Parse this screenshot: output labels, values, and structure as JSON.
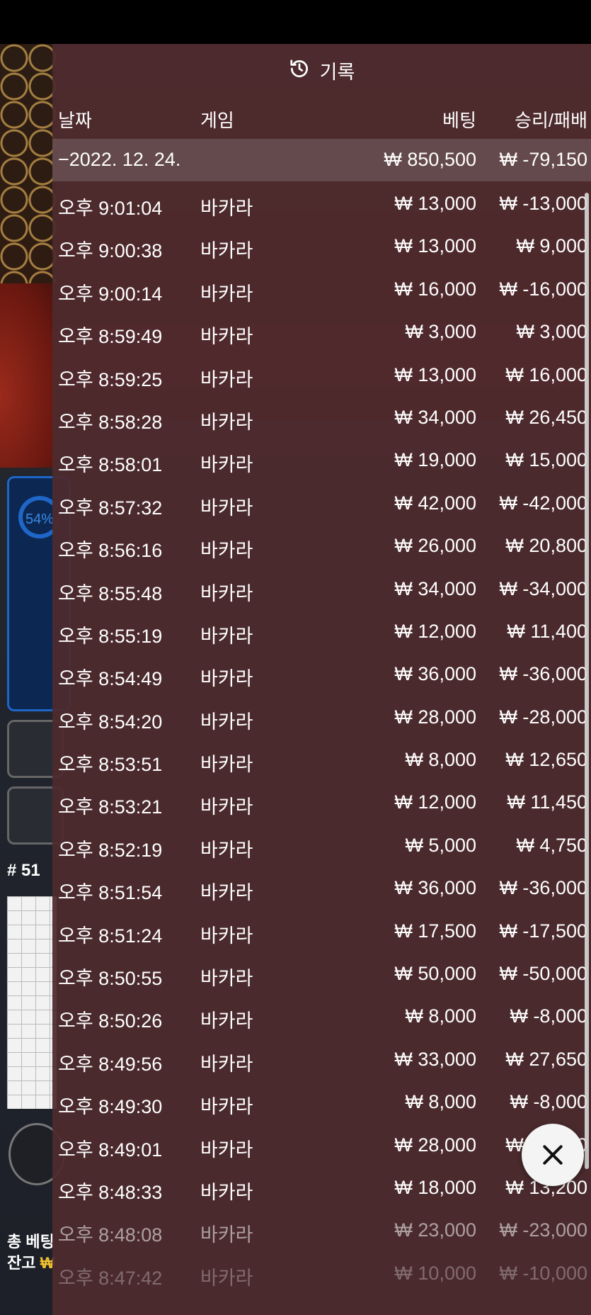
{
  "panel": {
    "title": "기록",
    "title_icon": "history-icon",
    "columns": {
      "date": "날짜",
      "game": "게임",
      "bet": "베팅",
      "result": "승리/패배"
    },
    "day": {
      "date": "−2022. 12. 24.",
      "bet": "₩ 850,500",
      "result": "₩ -79,150"
    },
    "rows": [
      {
        "time": "오후 9:01:04",
        "game": "바카라",
        "bet": "₩ 13,000",
        "result": "₩ -13,000"
      },
      {
        "time": "오후 9:00:38",
        "game": "바카라",
        "bet": "₩ 13,000",
        "result": "₩ 9,000"
      },
      {
        "time": "오후 9:00:14",
        "game": "바카라",
        "bet": "₩ 16,000",
        "result": "₩ -16,000"
      },
      {
        "time": "오후 8:59:49",
        "game": "바카라",
        "bet": "₩ 3,000",
        "result": "₩ 3,000"
      },
      {
        "time": "오후 8:59:25",
        "game": "바카라",
        "bet": "₩ 13,000",
        "result": "₩ 16,000"
      },
      {
        "time": "오후 8:58:28",
        "game": "바카라",
        "bet": "₩ 34,000",
        "result": "₩ 26,450"
      },
      {
        "time": "오후 8:58:01",
        "game": "바카라",
        "bet": "₩ 19,000",
        "result": "₩ 15,000"
      },
      {
        "time": "오후 8:57:32",
        "game": "바카라",
        "bet": "₩ 42,000",
        "result": "₩ -42,000"
      },
      {
        "time": "오후 8:56:16",
        "game": "바카라",
        "bet": "₩ 26,000",
        "result": "₩ 20,800"
      },
      {
        "time": "오후 8:55:48",
        "game": "바카라",
        "bet": "₩ 34,000",
        "result": "₩ -34,000"
      },
      {
        "time": "오후 8:55:19",
        "game": "바카라",
        "bet": "₩ 12,000",
        "result": "₩ 11,400"
      },
      {
        "time": "오후 8:54:49",
        "game": "바카라",
        "bet": "₩ 36,000",
        "result": "₩ -36,000"
      },
      {
        "time": "오후 8:54:20",
        "game": "바카라",
        "bet": "₩ 28,000",
        "result": "₩ -28,000"
      },
      {
        "time": "오후 8:53:51",
        "game": "바카라",
        "bet": "₩ 8,000",
        "result": "₩ 12,650"
      },
      {
        "time": "오후 8:53:21",
        "game": "바카라",
        "bet": "₩ 12,000",
        "result": "₩ 11,450"
      },
      {
        "time": "오후 8:52:19",
        "game": "바카라",
        "bet": "₩ 5,000",
        "result": "₩ 4,750"
      },
      {
        "time": "오후 8:51:54",
        "game": "바카라",
        "bet": "₩ 36,000",
        "result": "₩ -36,000"
      },
      {
        "time": "오후 8:51:24",
        "game": "바카라",
        "bet": "₩ 17,500",
        "result": "₩ -17,500"
      },
      {
        "time": "오후 8:50:55",
        "game": "바카라",
        "bet": "₩ 50,000",
        "result": "₩ -50,000"
      },
      {
        "time": "오후 8:50:26",
        "game": "바카라",
        "bet": "₩ 8,000",
        "result": "₩ -8,000"
      },
      {
        "time": "오후 8:49:56",
        "game": "바카라",
        "bet": "₩ 33,000",
        "result": "₩ 27,650"
      },
      {
        "time": "오후 8:49:30",
        "game": "바카라",
        "bet": "₩ 8,000",
        "result": "₩ -8,000"
      },
      {
        "time": "오후 8:49:01",
        "game": "바카라",
        "bet": "₩ 28,000",
        "result": "₩ 28,000"
      },
      {
        "time": "오후 8:48:33",
        "game": "바카라",
        "bet": "₩ 18,000",
        "result": "₩ 13,200"
      },
      {
        "time": "오후 8:48:08",
        "game": "바카라",
        "bet": "₩ 23,000",
        "result": "₩ -23,000"
      },
      {
        "time": "오후 8:47:42",
        "game": "바카라",
        "bet": "₩ 10,000",
        "result": "₩ -10,000"
      }
    ]
  },
  "close_icon": "close-icon",
  "background": {
    "win_rate": "54%",
    "round_no": "# 51",
    "total_bet_label": "총 베팅",
    "balance_label": "잔고",
    "balance_currency": "₩"
  }
}
